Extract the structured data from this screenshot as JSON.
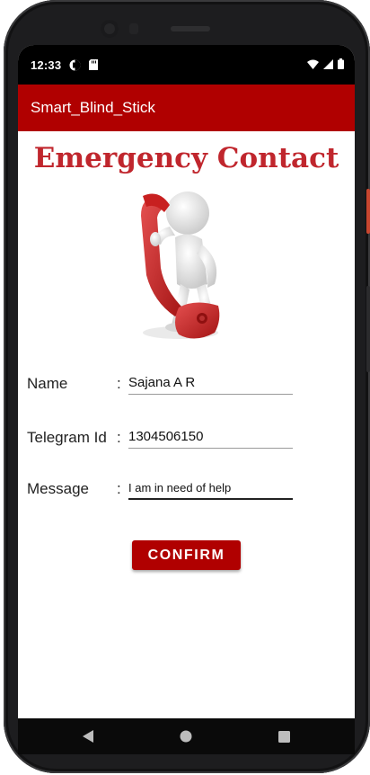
{
  "status_bar": {
    "time": "12:33",
    "icons": [
      "media-icon",
      "sd-card-icon",
      "wifi-icon",
      "signal-icon",
      "battery-icon"
    ]
  },
  "app_bar": {
    "title": "Smart_Blind_Stick"
  },
  "page": {
    "title": "Emergency Contact",
    "illustration": "person-with-phone-receiver"
  },
  "form": {
    "name": {
      "label": "Name",
      "colon": ":",
      "value": "Sajana A R"
    },
    "telegram": {
      "label": "Telegram Id",
      "colon": ":",
      "value": "1304506150"
    },
    "message": {
      "label": "Message",
      "colon": ":",
      "value": "I am in need of help"
    }
  },
  "confirm_label": "CONFIRM",
  "nav_bar": {
    "icons": [
      "back-icon",
      "home-icon",
      "recents-icon"
    ]
  },
  "colors": {
    "app_bar": "#b00000",
    "title": "#c0262d",
    "button": "#b00000",
    "phone": "#1d1d1f"
  }
}
